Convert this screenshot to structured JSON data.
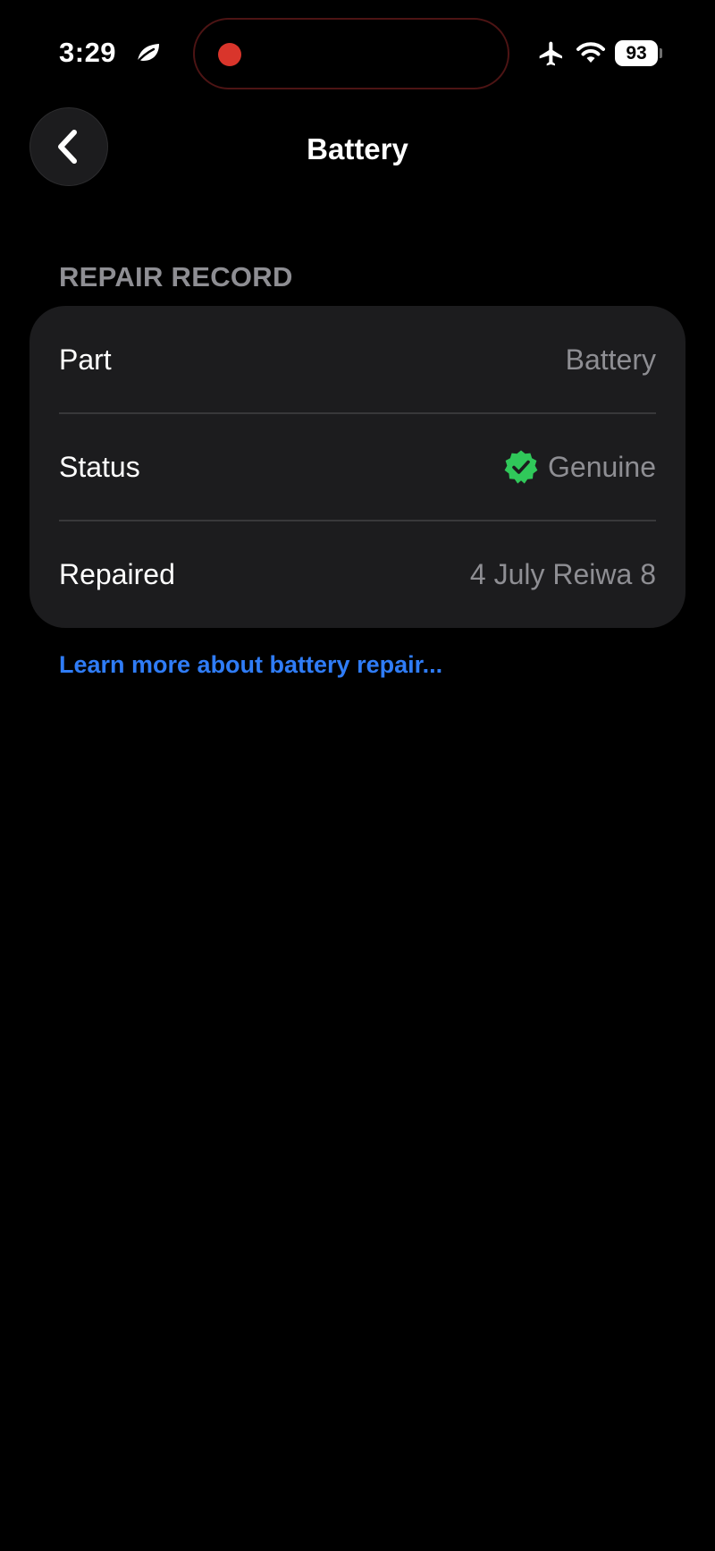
{
  "status_bar": {
    "time": "3:29",
    "battery_level": "93",
    "icons": [
      "leaf-icon",
      "airplane-icon",
      "wifi-icon",
      "battery-icon",
      "recording-indicator"
    ]
  },
  "nav": {
    "title": "Battery",
    "back_icon": "chevron-left-icon"
  },
  "repair_record": {
    "header": "REPAIR RECORD",
    "rows": [
      {
        "label": "Part",
        "value": "Battery"
      },
      {
        "label": "Status",
        "value": "Genuine",
        "icon": "verified-badge-icon"
      },
      {
        "label": "Repaired",
        "value": "4 July Reiwa 8"
      }
    ],
    "learn_more": "Learn more about battery repair..."
  },
  "colors": {
    "background": "#000000",
    "card": "#1c1c1e",
    "secondary_text": "#8e8e93",
    "link": "#2f7cf6",
    "verified_green": "#30c85a",
    "recording_red": "#d9352b"
  }
}
